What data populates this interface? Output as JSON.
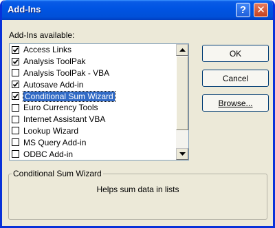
{
  "window": {
    "title": "Add-Ins",
    "help_glyph": "?",
    "close_glyph": "✕",
    "accent": "#0054e3",
    "selection_color": "#316ac5"
  },
  "addins": {
    "section_label": "Add-Ins available:",
    "items": [
      {
        "label": "Access Links",
        "checked": true,
        "selected": false
      },
      {
        "label": "Analysis ToolPak",
        "checked": true,
        "selected": false
      },
      {
        "label": "Analysis ToolPak - VBA",
        "checked": false,
        "selected": false
      },
      {
        "label": "Autosave Add-in",
        "checked": true,
        "selected": false
      },
      {
        "label": "Conditional Sum Wizard",
        "checked": true,
        "selected": true
      },
      {
        "label": "Euro Currency Tools",
        "checked": false,
        "selected": false
      },
      {
        "label": "Internet Assistant VBA",
        "checked": false,
        "selected": false
      },
      {
        "label": "Lookup Wizard",
        "checked": false,
        "selected": false
      },
      {
        "label": "MS Query Add-in",
        "checked": false,
        "selected": false
      },
      {
        "label": "ODBC Add-in",
        "checked": false,
        "selected": false
      }
    ]
  },
  "buttons": {
    "ok": "OK",
    "cancel": "Cancel",
    "browse": "Browse..."
  },
  "details": {
    "title": "Conditional Sum Wizard",
    "description": "Helps sum data in lists"
  }
}
